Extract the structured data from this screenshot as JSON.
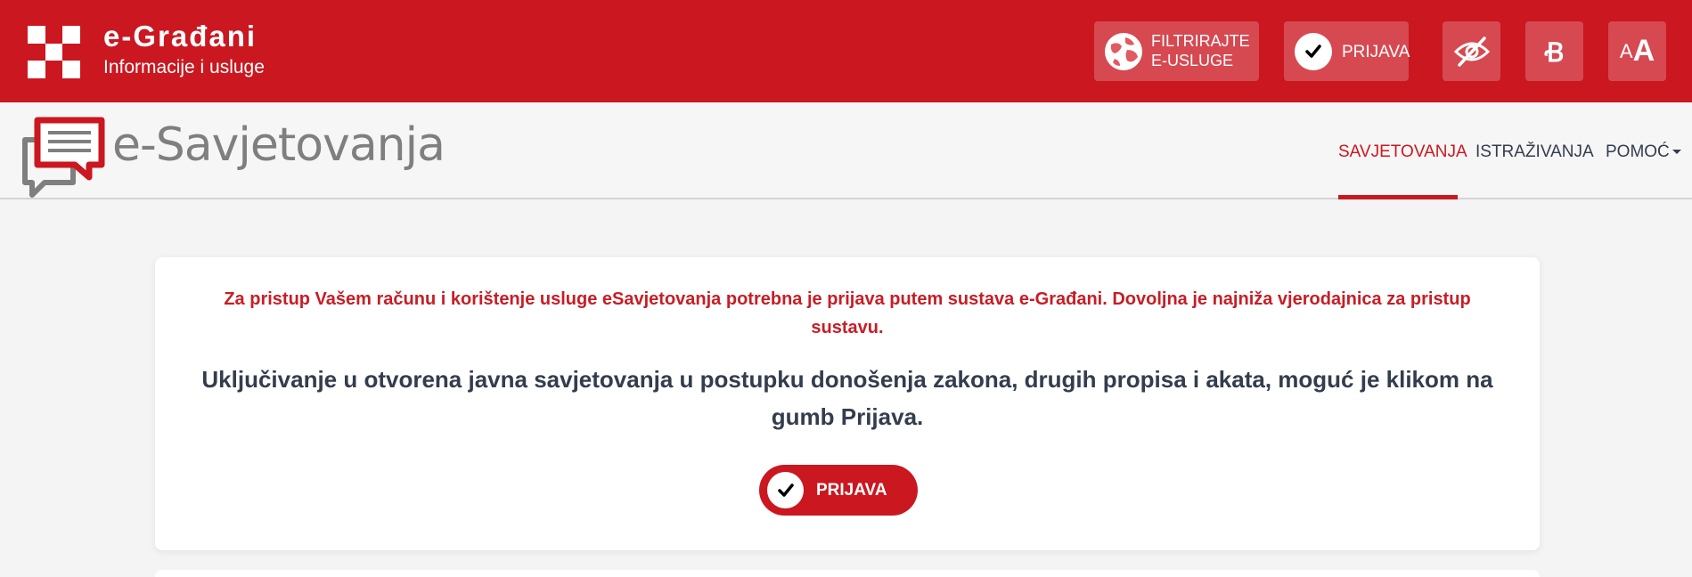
{
  "header": {
    "brand_title": "e-Građani",
    "brand_subtitle": "Informacije i usluge",
    "filter_line1": "FILTRIRAJTE",
    "filter_line2": "E-USLUGE",
    "login_label": "PRIJAVA",
    "font_toggle_glyph": "Ꞗ",
    "size_small": "A",
    "size_big": "A",
    "accent_color": "#cb1720"
  },
  "nav": {
    "logo_text": "e-Savjetovanja",
    "items": [
      {
        "label": "SAVJETOVANJA",
        "active": true
      },
      {
        "label": "ISTRAŽIVANJA",
        "active": false
      },
      {
        "label": "POMOĆ",
        "active": false
      }
    ]
  },
  "card": {
    "notice": "Za pristup Vašem računu i korištenje usluge eSavjetovanja potrebna je prijava putem sustava e-Građani. Dovoljna je najniža vjerodajnica za pristup sustavu.",
    "lead": "Uključivanje u otvorena javna savjetovanja u postupku donošenja zakona, drugih propisa i akata, moguć je klikom na gumb Prijava.",
    "login_label": "PRIJAVA"
  }
}
